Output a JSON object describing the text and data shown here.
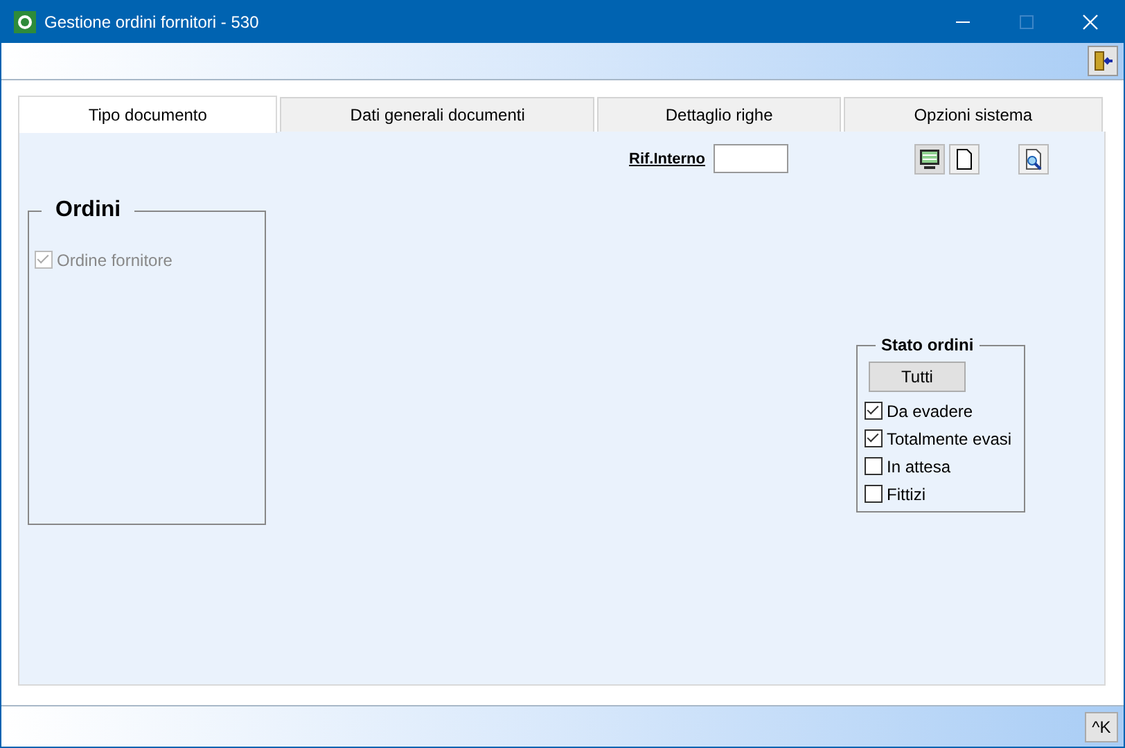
{
  "window": {
    "title": "Gestione ordini fornitori - 530"
  },
  "tabs": [
    {
      "label": "Tipo documento",
      "selected": true
    },
    {
      "label": "Dati generali documenti",
      "selected": false
    },
    {
      "label": "Dettaglio righe",
      "selected": false
    },
    {
      "label": "Opzioni sistema",
      "selected": false
    }
  ],
  "rif_interno": {
    "label": "Rif.Interno"
  },
  "ordini": {
    "title": "Ordini",
    "items": [
      {
        "label": "Ordine fornitore",
        "checked": true,
        "disabled": true
      }
    ]
  },
  "stato_ordini": {
    "title": "Stato ordini",
    "button": "Tutti",
    "items": [
      {
        "label": "Da evadere",
        "checked": true
      },
      {
        "label": "Totalmente evasi",
        "checked": true
      },
      {
        "label": "In attesa",
        "checked": false
      },
      {
        "label": "Fittizi",
        "checked": false
      }
    ]
  },
  "status_bar": {
    "button": "^K"
  }
}
